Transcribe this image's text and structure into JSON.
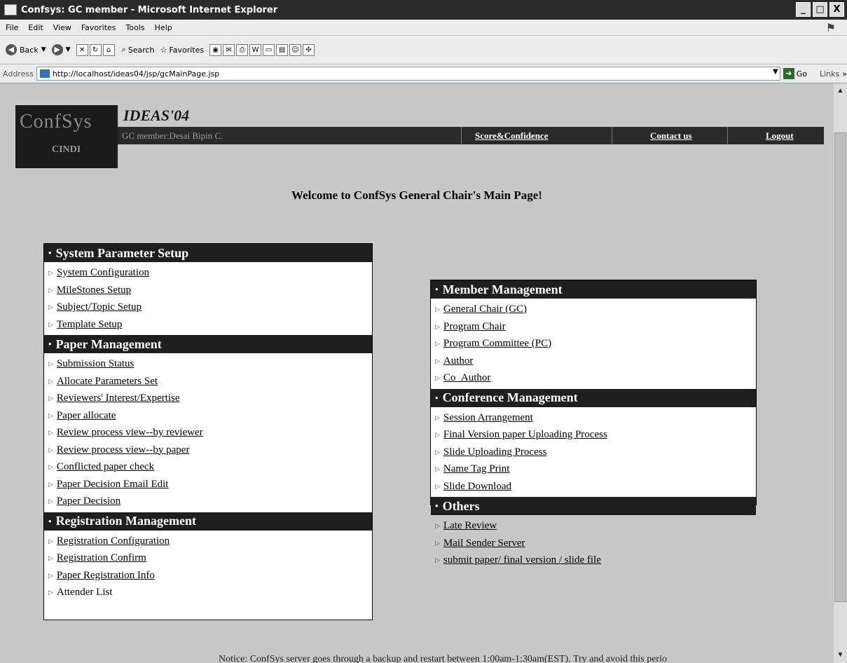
{
  "window": {
    "title": "Confsys: GC member - Microsoft Internet Explorer",
    "min": "_",
    "max": "□",
    "close": "X"
  },
  "menu": [
    "File",
    "Edit",
    "View",
    "Favorites",
    "Tools",
    "Help"
  ],
  "toolbar": {
    "back": "Back",
    "search": "Search",
    "favorites": "Favorites"
  },
  "address": {
    "label": "Address",
    "url": "http://localhost/ideas04/jsp/gcMainPage.jsp",
    "go": "Go",
    "links": "Links"
  },
  "logo": {
    "big": "ConfSys",
    "small": "CINDI"
  },
  "site": {
    "title": "IDEAS'04",
    "member": "GC member:Desai Bipin C.",
    "links": [
      "Score&Confidence",
      "Contact us",
      "Logout"
    ]
  },
  "welcome": "Welcome to ConfSys General Chair's Main Page!",
  "left_sections": [
    {
      "title": "System Parameter Setup",
      "items": [
        "System Configuration",
        "MileStones Setup",
        "Subject/Topic Setup",
        "Template Setup"
      ]
    },
    {
      "title": "Paper Management",
      "items": [
        "Submission Status",
        "Allocate Parameters Set",
        "Reviewers' Interest/Expertise",
        "Paper allocate",
        "Review process view--by reviewer",
        "Review process view--by paper",
        "Conflicted paper check",
        "Paper Decision Email Edit",
        "Paper Decision"
      ]
    },
    {
      "title": "Registration Management",
      "items": [
        "Registration Configuration",
        "Registration Confirm",
        "Paper Registration Info",
        "Attender List"
      ]
    }
  ],
  "right_sections": [
    {
      "title": "Member Management",
      "items": [
        "General Chair (GC)",
        "Program Chair",
        "Program Committee (PC)",
        "Author",
        "Co_Author"
      ]
    },
    {
      "title": "Conference Management",
      "items": [
        "Session Arrangement",
        "Final Version paper Uploading Process",
        "Slide Uploading Process",
        "Name Tag Print",
        "Slide Download"
      ]
    },
    {
      "title": "Others",
      "items": [
        "Late Review",
        "Mail Sender Server",
        "submit paper/ final version / slide file"
      ]
    }
  ],
  "notice": "Notice: ConfSys server goes through a backup and restart between 1:00am-1:30am(EST). Try and avoid this perio"
}
